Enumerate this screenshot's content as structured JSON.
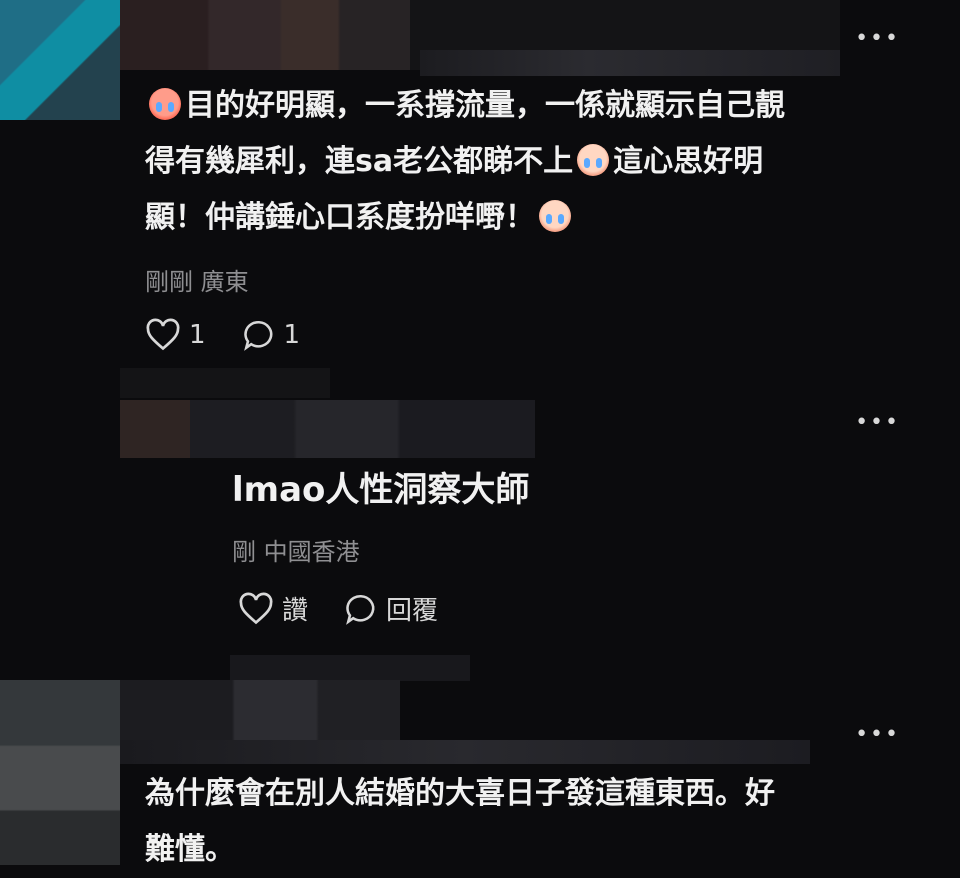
{
  "comment1": {
    "segments": [
      "目的好明顯，一系撐流量，一係就顯示自己靚",
      "得有幾犀利，連sa老公都睇不上",
      "這心思好明",
      "顯！仲講錘心口系度扮咩嘢！"
    ],
    "meta": "剛剛 廣東",
    "likes": "1",
    "replies": "1"
  },
  "reply": {
    "name": "lmao人性洞察大師",
    "meta": "剛 中國香港",
    "like_label": "讚",
    "reply_label": "回覆"
  },
  "comment2": {
    "line1": "為什麼會在別人結婚的大喜日子發這種東西。好",
    "line2": "難懂。"
  },
  "icons": {
    "more": "more-horizontal-icon",
    "like": "heart-outline-icon",
    "reply": "speech-bubble-icon",
    "emoji": "crying-face-emoji"
  }
}
